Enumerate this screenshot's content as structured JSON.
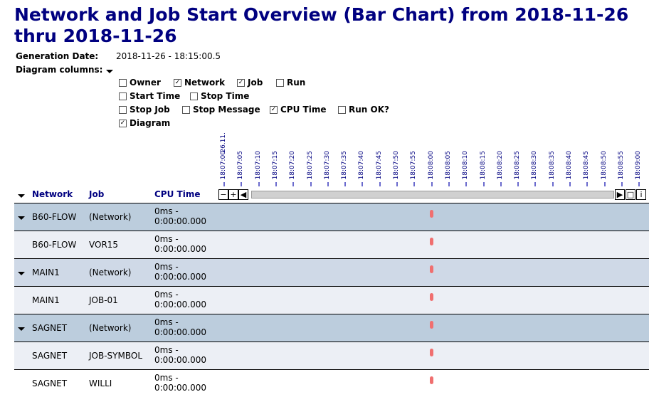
{
  "title": "Network and Job Start Overview (Bar Chart) from 2018-11-26 thru 2018-11-26",
  "generation_label": "Generation Date:",
  "generation_value": "2018-11-26 - 18:15:00.5",
  "diagram_columns_label": "Diagram columns:",
  "columns": [
    {
      "label": "Owner",
      "checked": false
    },
    {
      "label": "Network",
      "checked": true
    },
    {
      "label": "Job",
      "checked": true
    },
    {
      "label": "Run",
      "checked": false
    },
    {
      "label": "Start Time",
      "checked": false
    },
    {
      "label": "Stop Time",
      "checked": false
    },
    {
      "label": "Stop Job",
      "checked": false
    },
    {
      "label": "Stop Message",
      "checked": false
    },
    {
      "label": "CPU Time",
      "checked": true
    },
    {
      "label": "Run OK?",
      "checked": false
    },
    {
      "label": "Diagram",
      "checked": true
    }
  ],
  "table_headers": {
    "network": "Network",
    "job": "Job",
    "cpu": "CPU Time"
  },
  "timeline": {
    "date_label": "26.11.",
    "ticks": [
      "18:07:00",
      "18:07:05",
      "18:07:10",
      "18:07:15",
      "18:07:20",
      "18:07:25",
      "18:07:30",
      "18:07:35",
      "18:07:40",
      "18:07:45",
      "18:07:50",
      "18:07:55",
      "18:08:00",
      "18:08:05",
      "18:08:10",
      "18:08:15",
      "18:08:20",
      "18:08:25",
      "18:08:30",
      "18:08:35",
      "18:08:40",
      "18:08:45",
      "18:08:50",
      "18:08:55",
      "18:09:00"
    ],
    "buttons": {
      "zoom_out": "−",
      "zoom_in": "+",
      "left": "◀",
      "right": "▶",
      "fit": "□",
      "info": "i"
    },
    "marker_color": "#f06f6f"
  },
  "rows": [
    {
      "network": "B60-FLOW",
      "job": "(Network)",
      "cpu1": "0ms -",
      "cpu2": "0:00:00.000",
      "group": true,
      "start": "18:08:00",
      "bg": "#bccddd"
    },
    {
      "network": "B60-FLOW",
      "job": "VOR15",
      "cpu1": "0ms -",
      "cpu2": "0:00:00.000",
      "group": false,
      "start": "18:08:00",
      "bg": "#eceff5"
    },
    {
      "network": "MAIN1",
      "job": "(Network)",
      "cpu1": "0ms -",
      "cpu2": "0:00:00.000",
      "group": true,
      "start": "18:08:00",
      "bg": "#cfd9e7"
    },
    {
      "network": "MAIN1",
      "job": "JOB-01",
      "cpu1": "0ms -",
      "cpu2": "0:00:00.000",
      "group": false,
      "start": "18:08:00",
      "bg": "#eceff5"
    },
    {
      "network": "SAGNET",
      "job": "(Network)",
      "cpu1": "0ms -",
      "cpu2": "0:00:00.000",
      "group": true,
      "start": "18:08:00",
      "bg": "#bccddd"
    },
    {
      "network": "SAGNET",
      "job": "JOB-SYMBOL",
      "cpu1": "0ms -",
      "cpu2": "0:00:00.000",
      "group": false,
      "start": "18:08:00",
      "bg": "#eceff5"
    },
    {
      "network": "SAGNET",
      "job": "WILLI",
      "cpu1": "0ms -",
      "cpu2": "0:00:00.000",
      "group": false,
      "start": "18:08:00",
      "bg": "#ffffff"
    }
  ]
}
